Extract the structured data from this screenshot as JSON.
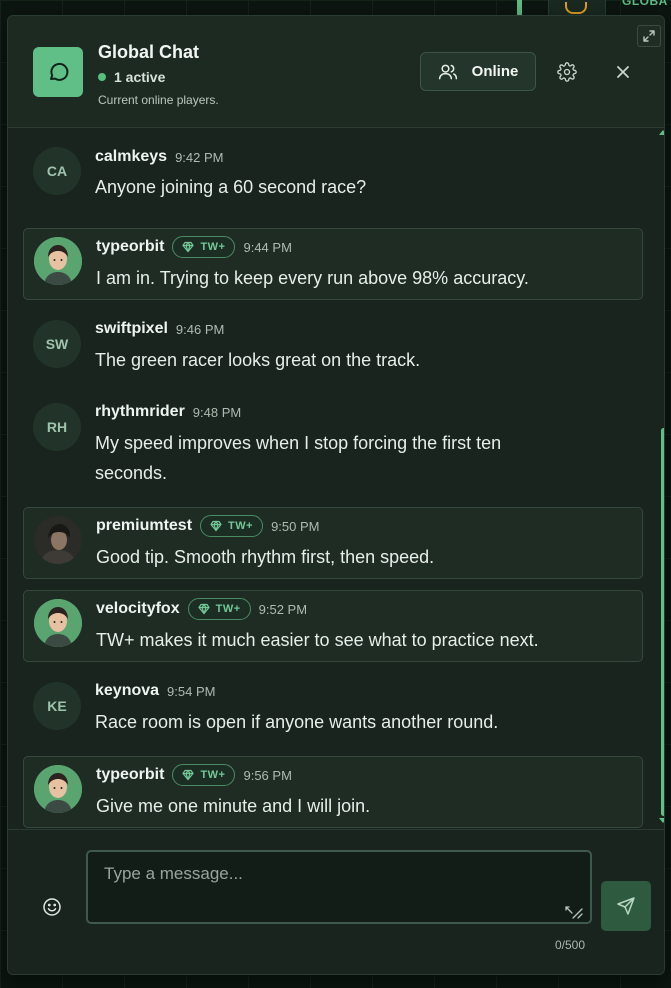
{
  "background": {
    "label": "GLOBA"
  },
  "header": {
    "title": "Global Chat",
    "active_text": "1 active",
    "subtitle": "Current online players.",
    "online_label": "Online"
  },
  "messages": [
    {
      "user": "calmkeys",
      "initials": "CA",
      "time": "9:42 PM",
      "text": "Anyone joining a 60 second race?",
      "tw": false
    },
    {
      "user": "typeorbit",
      "initials": "",
      "time": "9:44 PM",
      "text": "I am in. Trying to keep every run above 98% accuracy.",
      "tw": true,
      "badge": "TW+"
    },
    {
      "user": "swiftpixel",
      "initials": "SW",
      "time": "9:46 PM",
      "text": "The green racer looks great on the track.",
      "tw": false
    },
    {
      "user": "rhythmrider",
      "initials": "RH",
      "time": "9:48 PM",
      "text": "My speed improves when I stop forcing the first ten seconds.",
      "tw": false
    },
    {
      "user": "premiumtest",
      "initials": "",
      "time": "9:50 PM",
      "text": "Good tip. Smooth rhythm first, then speed.",
      "tw": true,
      "badge": "TW+"
    },
    {
      "user": "velocityfox",
      "initials": "",
      "time": "9:52 PM",
      "text": "TW+ makes it much easier to see what to practice next.",
      "tw": true,
      "badge": "TW+"
    },
    {
      "user": "keynova",
      "initials": "KE",
      "time": "9:54 PM",
      "text": "Race room is open if anyone wants another round.",
      "tw": false
    },
    {
      "user": "typeorbit",
      "initials": "",
      "time": "9:56 PM",
      "text": "Give me one minute and I will join.",
      "tw": true,
      "badge": "TW+"
    }
  ],
  "composer": {
    "placeholder": "Type a message...",
    "value": "",
    "char_count": "0/500"
  },
  "colors": {
    "accent": "#5fbf86",
    "panel": "#18241d",
    "status_online": "#56c17d",
    "badge": "#74c797"
  },
  "icons": [
    "chat-bubble-icon",
    "users-icon",
    "gear-icon",
    "close-icon",
    "expand-icon",
    "emoji-icon",
    "send-icon",
    "gem-icon",
    "trophy-icon"
  ]
}
